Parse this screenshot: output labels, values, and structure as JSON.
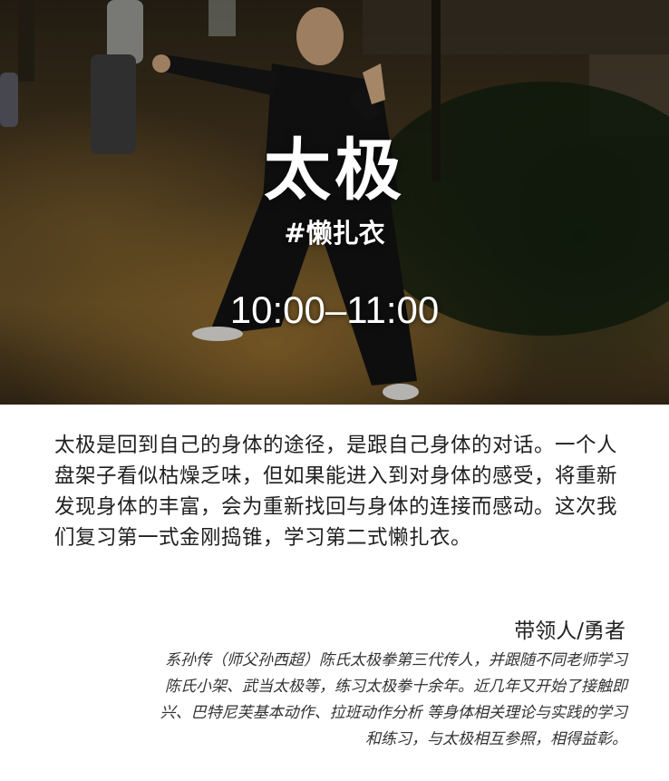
{
  "hero": {
    "title": "太极",
    "tag": "#懒扎衣",
    "time": "10:00–11:00"
  },
  "description": "太极是回到自己的身体的途径，是跟自己身体的对话。一个人盘架子看似枯燥乏味，但如果能进入到对身体的感受，将重新发现身体的丰富，会为重新找回与身体的连接而感动。这次我们复习第一式金刚捣锥，学习第二式懒扎衣。",
  "leader": "带领人/勇者",
  "bio": {
    "lines": [
      "系孙传（师父孙西超）陈氏太极拳第三代传人，并跟随不同老师学习",
      "陈氏小架、武当太极等，练习太极拳十余年。近几年又开始了接触即",
      "兴、巴特尼芙基本动作、拉班动作分析 等身体相关理论与实践的学习",
      "和练习，与太极相互参照，相得益彰。"
    ]
  },
  "colors": {
    "hero_text": "#ffffff",
    "body_text": "#1f1f1f",
    "background": "#ffffff"
  }
}
